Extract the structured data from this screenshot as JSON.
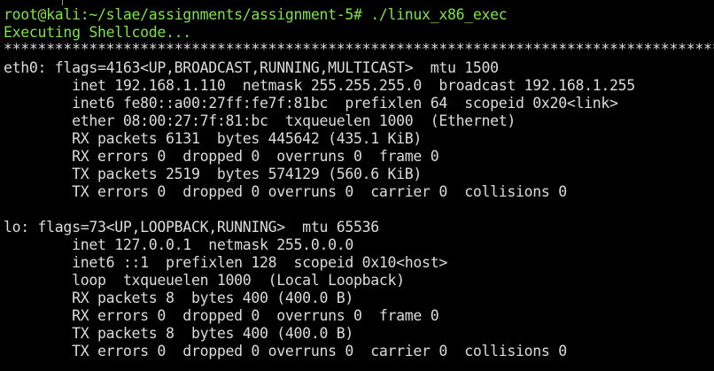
{
  "colors": {
    "background": "#000000",
    "prompt": "#7ee24a",
    "output": "#dcdcdc"
  },
  "terminal": {
    "prompt_line": "root@kali:~/slae/assignments/assignment-5# ./linux_x86_exec",
    "executing": "Executing Shellcode...",
    "separator": "*******************************************************************************************************************",
    "eth0": {
      "header": "eth0: flags=4163<UP,BROADCAST,RUNNING,MULTICAST>  mtu 1500",
      "inet": "        inet 192.168.1.110  netmask 255.255.255.0  broadcast 192.168.1.255",
      "inet6": "        inet6 fe80::a00:27ff:fe7f:81bc  prefixlen 64  scopeid 0x20<link>",
      "ether": "        ether 08:00:27:7f:81:bc  txqueuelen 1000  (Ethernet)",
      "rx_packets": "        RX packets 6131  bytes 445642 (435.1 KiB)",
      "rx_errors": "        RX errors 0  dropped 0  overruns 0  frame 0",
      "tx_packets": "        TX packets 2519  bytes 574129 (560.6 KiB)",
      "tx_errors": "        TX errors 0  dropped 0 overruns 0  carrier 0  collisions 0"
    },
    "lo": {
      "header": "lo: flags=73<UP,LOOPBACK,RUNNING>  mtu 65536",
      "inet": "        inet 127.0.0.1  netmask 255.0.0.0",
      "inet6": "        inet6 ::1  prefixlen 128  scopeid 0x10<host>",
      "loop": "        loop  txqueuelen 1000  (Local Loopback)",
      "rx_packets": "        RX packets 8  bytes 400 (400.0 B)",
      "rx_errors": "        RX errors 0  dropped 0  overruns 0  frame 0",
      "tx_packets": "        TX packets 8  bytes 400 (400.0 B)",
      "tx_errors": "        TX errors 0  dropped 0 overruns 0  carrier 0  collisions 0"
    }
  }
}
